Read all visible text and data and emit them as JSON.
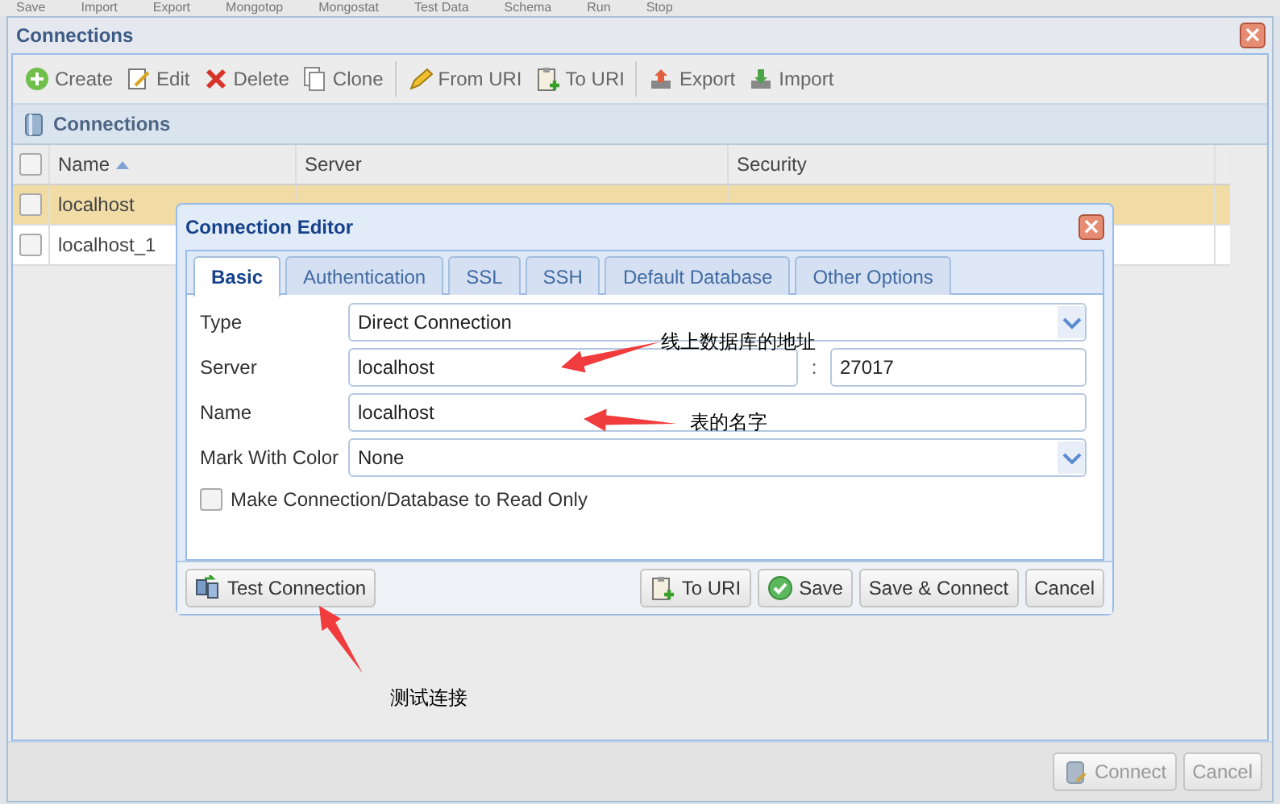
{
  "top_toolbar": [
    "Save",
    "Import",
    "Export",
    "Mongotop",
    "Mongostat",
    "Test Data",
    "Schema",
    "Run",
    "Stop"
  ],
  "window": {
    "title": "Connections",
    "close": "×"
  },
  "toolbar": [
    [
      "Create",
      "Edit",
      "Delete",
      "Clone"
    ],
    [
      "From URI",
      "To URI"
    ],
    [
      "Export",
      "Import"
    ]
  ],
  "panel": {
    "title": "Connections"
  },
  "table": {
    "all_checked": false,
    "columns": [
      {
        "label": "Name",
        "sorted": true
      },
      {
        "label": "Server",
        "sorted": false
      },
      {
        "label": "Security",
        "sorted": false
      }
    ],
    "rows": [
      {
        "name": "localhost",
        "selected": true,
        "checked": false
      },
      {
        "name": "localhost_1",
        "selected": false,
        "checked": false
      }
    ]
  },
  "footer_buttons": [
    {
      "label": "Connect",
      "disabled": true
    },
    {
      "label": "Cancel",
      "disabled": true
    }
  ],
  "dialog": {
    "title": "Connection Editor",
    "close": "×",
    "tabs": [
      {
        "label": "Basic",
        "selected": true
      },
      {
        "label": "Authentication",
        "selected": false
      },
      {
        "label": "SSL",
        "selected": false
      },
      {
        "label": "SSH",
        "selected": false
      },
      {
        "label": "Default Database",
        "selected": false
      },
      {
        "label": "Other Options",
        "selected": false
      }
    ],
    "fields": [
      {
        "kind": "select",
        "label": "Type",
        "value": "Direct Connection"
      },
      {
        "kind": "hostport",
        "label": "Server",
        "value": "localhost",
        "separator": ":",
        "port": "27017"
      },
      {
        "kind": "text",
        "label": "Name",
        "value": "localhost"
      },
      {
        "kind": "select",
        "label": "Mark With Color",
        "value": "None"
      }
    ],
    "checkbox": {
      "label": "Make Connection/Database to Read Only",
      "checked": false
    },
    "left_button": {
      "label": "Test Connection"
    },
    "buttons": [
      "To URI",
      "Save",
      "Save & Connect",
      "Cancel"
    ]
  },
  "annotations": [
    {
      "text": "线上数据库的地址"
    },
    {
      "text": "表的名字"
    },
    {
      "text": "测试连接"
    }
  ]
}
